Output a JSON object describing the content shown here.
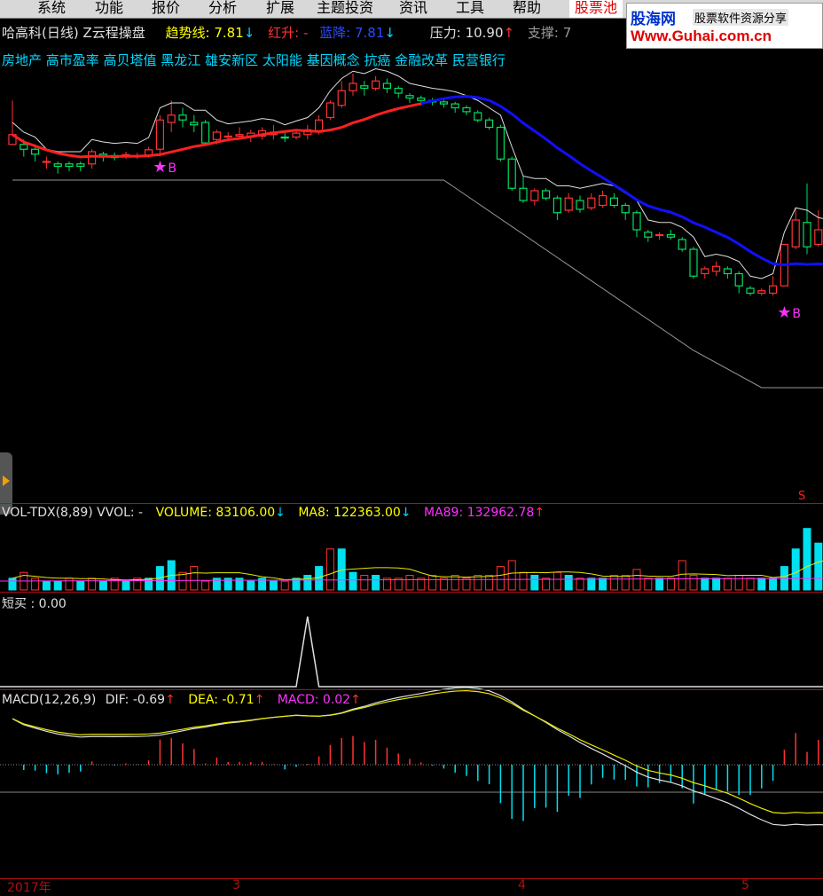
{
  "menu": [
    "系统",
    "功能",
    "报价",
    "分析",
    "扩展",
    "主题投资",
    "资讯",
    "工具",
    "帮助",
    "股票池"
  ],
  "logo": {
    "brand": "股海网",
    "sub": "股票软件资源分享",
    "url": "Www.Guhai.com.cn"
  },
  "header": {
    "stock": "哈高科(日线) Z云程操盘",
    "trend_label": "趋势线: 7.81",
    "trend_arrow": "↓",
    "red_label": "红升: -",
    "blue_label": "蓝降: 7.81",
    "blue_arrow": "↓",
    "pressure_label": "压力: 10.90",
    "pressure_arrow": "↑",
    "support_label": "支撑: 7"
  },
  "concepts": "房地产 高市盈率 高贝塔值 黑龙江 雄安新区 太阳能 基因概念 抗癌 金融改革 民营银行",
  "buy_marker": "B",
  "s_marker": "S",
  "vol": {
    "title": "VOL-TDX(8,89)",
    "vvol": "VVOL: -",
    "volume": "VOLUME: 83106.00",
    "volume_arrow": "↓",
    "ma8": "MA8: 122363.00",
    "ma8_arrow": "↓",
    "ma89": "MA89: 132962.78",
    "ma89_arrow": "↑"
  },
  "short_buy": {
    "label": "短买 : 0.00"
  },
  "macd": {
    "title": "MACD(12,26,9)",
    "dif": "DIF: -0.69",
    "dif_arrow": "↑",
    "dea": "DEA: -0.71",
    "dea_arrow": "↑",
    "macd": "MACD: 0.02",
    "macd_arrow": "↑"
  },
  "dates": [
    "2017年",
    "3",
    "4",
    "5"
  ],
  "colors": {
    "up": "#ff3232",
    "down": "#00e060",
    "vol_down": "#00e0f0",
    "trend_up": "#ff2020",
    "trend_down": "#1010ff",
    "white": "#e0e0e0",
    "yellow": "#e8e800",
    "magenta": "#ff30ff",
    "sep": "#b01010"
  },
  "candles": [
    [
      8.95,
      9.15,
      9.05,
      9.85
    ],
    [
      8.95,
      8.85,
      8.7,
      9.05
    ],
    [
      8.85,
      8.75,
      8.6,
      8.95
    ],
    [
      8.6,
      8.6,
      8.45,
      8.7
    ],
    [
      8.55,
      8.5,
      8.35,
      8.6
    ],
    [
      8.55,
      8.5,
      8.4,
      8.6
    ],
    [
      8.55,
      8.5,
      8.4,
      8.6
    ],
    [
      8.55,
      8.8,
      8.45,
      8.85
    ],
    [
      8.75,
      8.7,
      8.6,
      8.8
    ],
    [
      8.72,
      8.68,
      8.62,
      8.78
    ],
    [
      8.7,
      8.74,
      8.65,
      8.8
    ],
    [
      8.7,
      8.72,
      8.65,
      8.78
    ],
    [
      8.72,
      8.84,
      8.68,
      8.9
    ],
    [
      8.85,
      9.45,
      8.7,
      9.55
    ],
    [
      9.4,
      9.55,
      9.2,
      9.85
    ],
    [
      9.55,
      9.45,
      9.3,
      9.7
    ],
    [
      9.4,
      9.35,
      9.2,
      9.55
    ],
    [
      9.4,
      8.98,
      8.95,
      9.45
    ],
    [
      9.05,
      9.2,
      8.95,
      9.25
    ],
    [
      9.1,
      9.12,
      9.05,
      9.2
    ],
    [
      9.12,
      9.15,
      9.05,
      9.3
    ],
    [
      9.1,
      9.18,
      9.0,
      9.25
    ],
    [
      9.12,
      9.23,
      9.05,
      9.3
    ],
    [
      9.15,
      9.2,
      9.05,
      9.35
    ],
    [
      9.1,
      9.08,
      9.0,
      9.2
    ],
    [
      9.1,
      9.18,
      9.05,
      9.25
    ],
    [
      9.15,
      9.25,
      9.05,
      9.35
    ],
    [
      9.2,
      9.45,
      9.15,
      9.55
    ],
    [
      9.5,
      9.8,
      9.45,
      9.85
    ],
    [
      9.75,
      10.05,
      9.7,
      10.25
    ],
    [
      10.05,
      10.2,
      9.95,
      10.4
    ],
    [
      10.15,
      10.1,
      9.95,
      10.25
    ],
    [
      10.1,
      10.25,
      10.05,
      10.35
    ],
    [
      10.2,
      10.1,
      10.0,
      10.3
    ],
    [
      10.1,
      10.0,
      9.9,
      10.15
    ],
    [
      9.95,
      9.9,
      9.8,
      10.0
    ],
    [
      9.9,
      9.85,
      9.75,
      9.95
    ],
    [
      9.85,
      9.82,
      9.75,
      9.9
    ],
    [
      9.82,
      9.78,
      9.7,
      9.86
    ],
    [
      9.78,
      9.7,
      9.6,
      9.82
    ],
    [
      9.7,
      9.62,
      9.55,
      9.75
    ],
    [
      9.6,
      9.45,
      9.4,
      9.65
    ],
    [
      9.45,
      9.3,
      9.25,
      9.5
    ],
    [
      9.3,
      8.65,
      8.6,
      9.35
    ],
    [
      8.65,
      8.05,
      8.0,
      8.7
    ],
    [
      8.05,
      7.8,
      7.75,
      8.3
    ],
    [
      7.8,
      8.0,
      7.7,
      8.05
    ],
    [
      8.0,
      7.85,
      7.8,
      8.05
    ],
    [
      7.85,
      7.55,
      7.4,
      7.9
    ],
    [
      7.6,
      7.85,
      7.55,
      7.95
    ],
    [
      7.8,
      7.62,
      7.55,
      7.9
    ],
    [
      7.65,
      7.85,
      7.6,
      7.95
    ],
    [
      7.7,
      7.9,
      7.65,
      8.0
    ],
    [
      7.85,
      7.7,
      7.65,
      7.95
    ],
    [
      7.7,
      7.55,
      7.4,
      7.75
    ],
    [
      7.55,
      7.2,
      7.05,
      7.6
    ],
    [
      7.15,
      7.05,
      6.95,
      7.2
    ],
    [
      7.1,
      7.1,
      7.0,
      7.15
    ],
    [
      7.1,
      7.05,
      7.0,
      7.2
    ],
    [
      7.0,
      6.8,
      6.75,
      7.05
    ],
    [
      6.8,
      6.25,
      6.2,
      6.85
    ],
    [
      6.3,
      6.4,
      6.2,
      6.45
    ],
    [
      6.35,
      6.45,
      6.25,
      6.55
    ],
    [
      6.4,
      6.3,
      6.2,
      6.45
    ],
    [
      6.3,
      6.05,
      5.9,
      6.35
    ],
    [
      6.0,
      5.9,
      5.85,
      6.05
    ],
    [
      5.9,
      5.95,
      5.85,
      6.0
    ],
    [
      5.9,
      6.05,
      5.85,
      6.25
    ],
    [
      6.05,
      6.9,
      6.05,
      6.9
    ],
    [
      6.85,
      7.4,
      6.8,
      7.65
    ],
    [
      7.35,
      6.85,
      6.7,
      8.15
    ],
    [
      6.9,
      7.2,
      6.85,
      7.6
    ],
    [
      7.15,
      6.6,
      6.55,
      7.25
    ],
    [
      6.55,
      6.45,
      6.4,
      6.6
    ],
    [
      6.4,
      6.2,
      6.05,
      6.45
    ],
    [
      6.2,
      6.05,
      5.95,
      6.25
    ],
    [
      6.05,
      6.2,
      5.95,
      6.3
    ]
  ],
  "volume": [
    4,
    6,
    4,
    3,
    3,
    4,
    3,
    4,
    3,
    4,
    3,
    4,
    4,
    8,
    10,
    6,
    8,
    3,
    4,
    4,
    4,
    3,
    4,
    3,
    3,
    4,
    5,
    8,
    14,
    14,
    6,
    5,
    5,
    4,
    4,
    5,
    4,
    5,
    4,
    5,
    4,
    5,
    5,
    8,
    10,
    6,
    5,
    4,
    6,
    5,
    4,
    4,
    4,
    5,
    5,
    7,
    4,
    4,
    4,
    10,
    5,
    4,
    4,
    4,
    5,
    4,
    4,
    4,
    8,
    14,
    21,
    16,
    13,
    11,
    7,
    6,
    6
  ],
  "volume_up": [
    1,
    0,
    0,
    1,
    1,
    0,
    1,
    0,
    1,
    0,
    1,
    0,
    1,
    1,
    1,
    0,
    0,
    0,
    1,
    1,
    1,
    1,
    1,
    1,
    0,
    1,
    1,
    1,
    0,
    1,
    1,
    0,
    1,
    0,
    0,
    0,
    0,
    0,
    0,
    0,
    0,
    0,
    0,
    0,
    0,
    0,
    1,
    0,
    0,
    1,
    0,
    1,
    1,
    0,
    0,
    0,
    0,
    1,
    0,
    0,
    0,
    1,
    1,
    0,
    0,
    0,
    1,
    1,
    1,
    1,
    1,
    1,
    0,
    0,
    0,
    0,
    1
  ]
}
